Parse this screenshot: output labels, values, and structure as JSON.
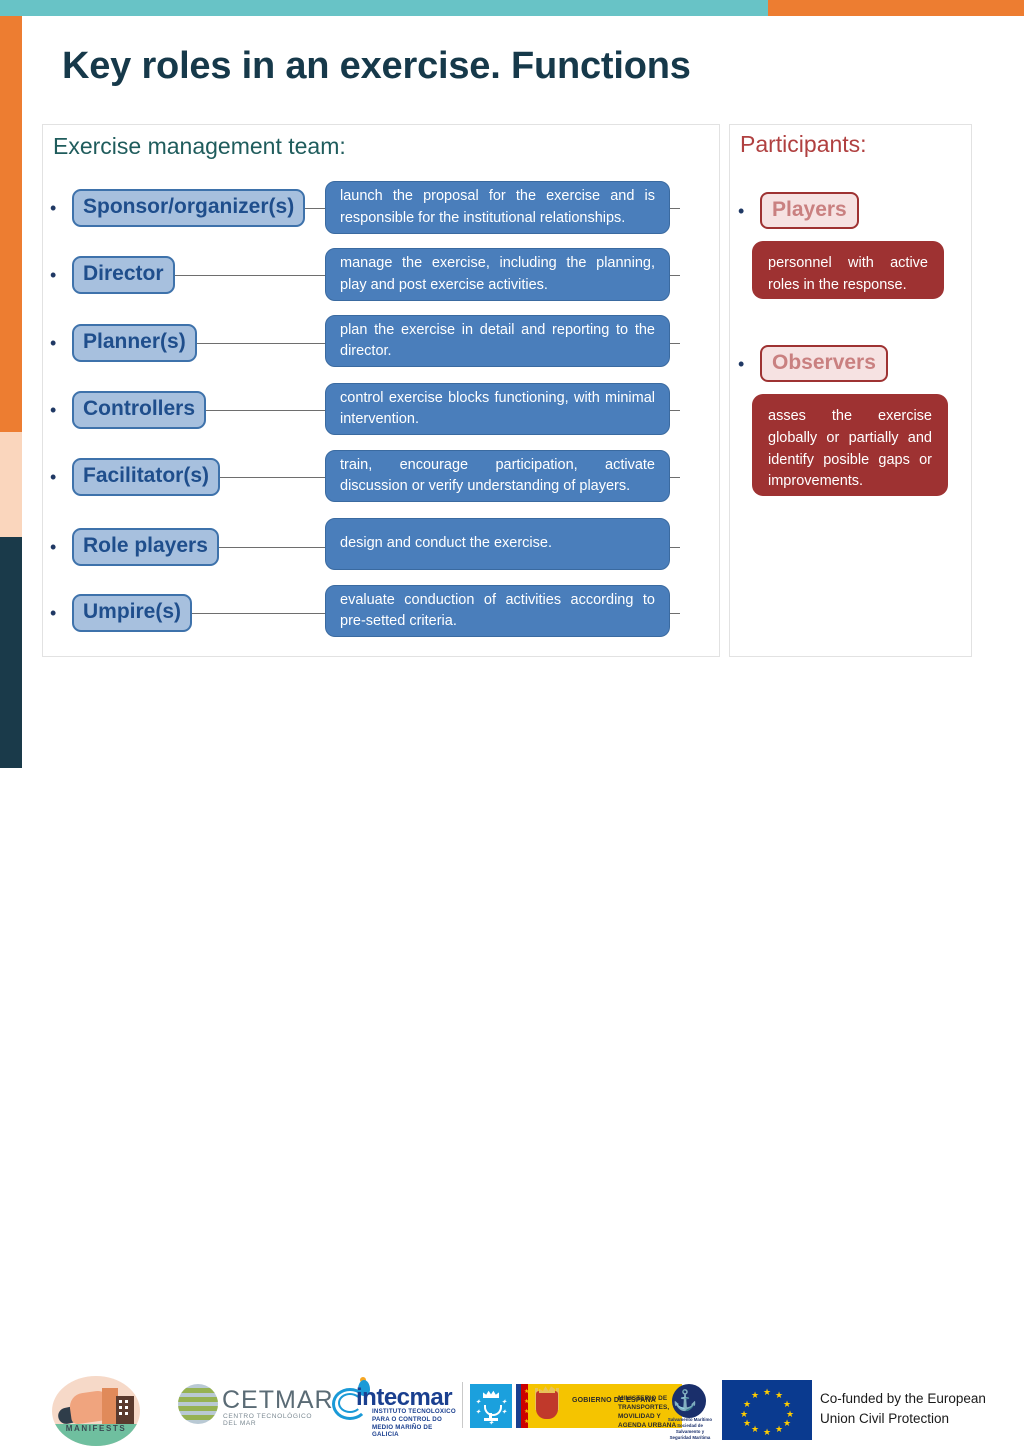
{
  "slide": {
    "title": "Key roles in an exercise. Functions"
  },
  "accent_colors": {
    "top_bar_teal": "#68c3c6",
    "top_bar_orange": "#ed7d31",
    "side_orange": "#ed7d31",
    "side_peach": "#fad6bd",
    "side_navy": "#1a3a4a",
    "title": "#16394a",
    "left_heading": "#1f5c5c",
    "right_heading": "#b04040",
    "role_chip_fill": "#a7c0de",
    "role_chip_border": "#3e72ab",
    "role_chip_text": "#1f4e8c",
    "desc_box_fill": "#4a7ebb",
    "participant_chip_fill": "#f6e2e2",
    "participant_chip_border": "#9e3232",
    "participant_chip_text": "#c98080",
    "participant_desc_fill": "#9e3232"
  },
  "left_column": {
    "heading": "Exercise management team:",
    "roles": [
      {
        "label": "Sponsor/organizer(s)",
        "description": "launch the proposal for the exercise and is responsible for the institutional relationships."
      },
      {
        "label": "Director",
        "description": "manage the exercise, including the planning, play and post exercise activities."
      },
      {
        "label": "Planner(s)",
        "description": "plan the exercise in detail and reporting to the director."
      },
      {
        "label": "Controllers",
        "description": "control exercise blocks functioning, with minimal intervention."
      },
      {
        "label": "Facilitator(s)",
        "description": "train, encourage participation, activate discussion or verify understanding of players."
      },
      {
        "label": "Role players",
        "description": "design and conduct the exercise."
      },
      {
        "label": "Umpire(s)",
        "description": "evaluate conduction of activities according to pre-setted criteria."
      }
    ]
  },
  "right_column": {
    "heading": "Participants:",
    "participants": [
      {
        "label": "Players",
        "description": "personnel with active roles in the response."
      },
      {
        "label": "Observers",
        "description": "asses the exercise globally or partially and identify posible gaps or improvements."
      }
    ]
  },
  "footer": {
    "logos": {
      "manifests": {
        "name": "MANIFESTS"
      },
      "cetmar": {
        "name": "CETMAR",
        "subtitle": "CENTRO TECNOLÓGICO DEL MAR"
      },
      "intecmar": {
        "name": "intecmar",
        "subtitle": "INSTITUTO TECNOLOXICO PARA O CONTROL DO MEDIO MARIÑO DE GALICIA"
      },
      "xunta": {
        "name": "Xunta de Galicia"
      },
      "gobierno": {
        "line1": "GOBIERNO\nDE ESPAÑA",
        "line2": "MINISTERIO\nDE TRANSPORTES, MOVILIDAD\nY AGENDA URBANA"
      },
      "salvamento": {
        "name": "Salvamento Marítimo\nSociedad de Salvamento y Seguridad Marítima"
      }
    },
    "eu_funding": {
      "line1": "Co-funded by the European",
      "line2": "Union Civil Protection"
    }
  }
}
